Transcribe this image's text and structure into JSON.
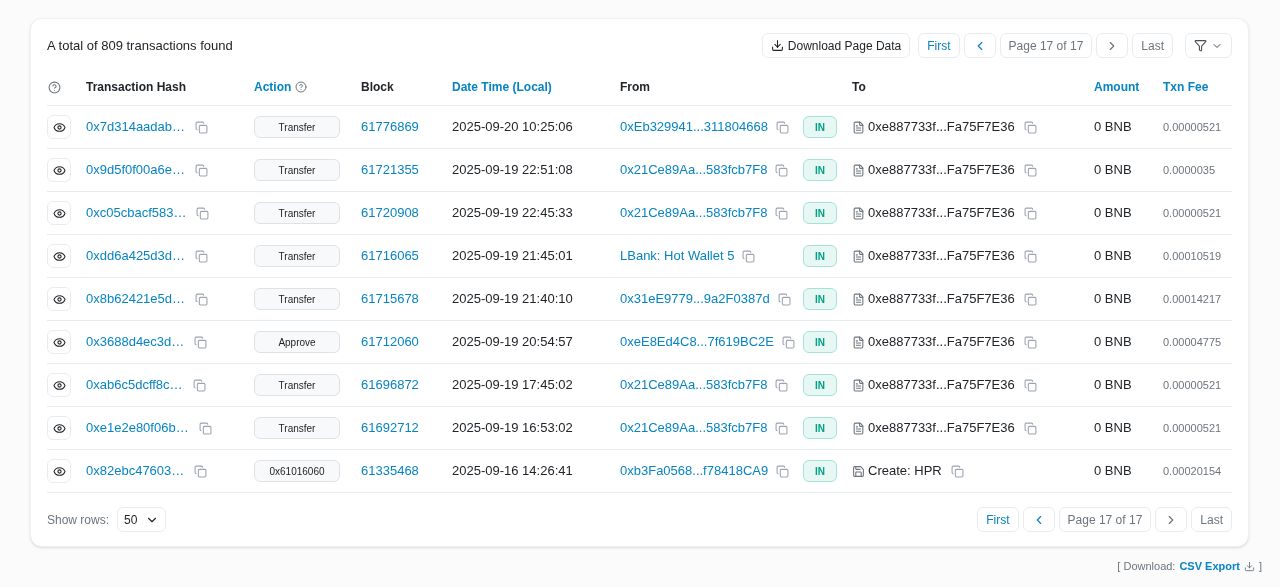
{
  "summary": "A total of 809 transactions found",
  "toolbar": {
    "download": "Download Page Data"
  },
  "pager_top": {
    "first": {
      "label": "First",
      "disabled": false
    },
    "prev_disabled": false,
    "page": "Page 17 of 17",
    "next_disabled": true,
    "last": {
      "label": "Last",
      "disabled": true
    }
  },
  "columns": [
    {
      "label": "Transaction Hash",
      "link": false,
      "help": false
    },
    {
      "label": "Action",
      "link": true,
      "help": true
    },
    {
      "label": "Block",
      "link": false,
      "help": false
    },
    {
      "label": "Date Time (Local)",
      "link": true,
      "help": false
    },
    {
      "label": "From",
      "link": false,
      "help": false
    },
    {
      "label": "To",
      "link": false,
      "help": false
    },
    {
      "label": "Amount",
      "link": true,
      "help": false
    },
    {
      "label": "Txn Fee",
      "link": true,
      "help": false
    }
  ],
  "rows": [
    {
      "hash": "0x7d314aadab…",
      "action": "Transfer",
      "block": "61776869",
      "time": "2025-09-20 10:25:06",
      "from": "0xEb329941...311804668",
      "direction": "IN",
      "to": {
        "kind": "contract",
        "text": "0xe887733f...Fa75F7E36"
      },
      "amount": "0 BNB",
      "fee": "0.00000521"
    },
    {
      "hash": "0x9d5f0f00a6e…",
      "action": "Transfer",
      "block": "61721355",
      "time": "2025-09-19 22:51:08",
      "from": "0x21Ce89Aa...583fcb7F8",
      "direction": "IN",
      "to": {
        "kind": "contract",
        "text": "0xe887733f...Fa75F7E36"
      },
      "amount": "0 BNB",
      "fee": "0.0000035"
    },
    {
      "hash": "0xc05cbacf583…",
      "action": "Transfer",
      "block": "61720908",
      "time": "2025-09-19 22:45:33",
      "from": "0x21Ce89Aa...583fcb7F8",
      "direction": "IN",
      "to": {
        "kind": "contract",
        "text": "0xe887733f...Fa75F7E36"
      },
      "amount": "0 BNB",
      "fee": "0.00000521"
    },
    {
      "hash": "0xdd6a425d3d…",
      "action": "Transfer",
      "block": "61716065",
      "time": "2025-09-19 21:45:01",
      "from": "LBank: Hot Wallet 5",
      "direction": "IN",
      "to": {
        "kind": "contract",
        "text": "0xe887733f...Fa75F7E36"
      },
      "amount": "0 BNB",
      "fee": "0.00010519"
    },
    {
      "hash": "0x8b62421e5d…",
      "action": "Transfer",
      "block": "61715678",
      "time": "2025-09-19 21:40:10",
      "from": "0x31eE9779...9a2F0387d",
      "direction": "IN",
      "to": {
        "kind": "contract",
        "text": "0xe887733f...Fa75F7E36"
      },
      "amount": "0 BNB",
      "fee": "0.00014217"
    },
    {
      "hash": "0x3688d4ec3d…",
      "action": "Approve",
      "block": "61712060",
      "time": "2025-09-19 20:54:57",
      "from": "0xeE8Ed4C8...7f619BC2E",
      "direction": "IN",
      "to": {
        "kind": "contract",
        "text": "0xe887733f...Fa75F7E36"
      },
      "amount": "0 BNB",
      "fee": "0.00004775"
    },
    {
      "hash": "0xab6c5dcff8c…",
      "action": "Transfer",
      "block": "61696872",
      "time": "2025-09-19 17:45:02",
      "from": "0x21Ce89Aa...583fcb7F8",
      "direction": "IN",
      "to": {
        "kind": "contract",
        "text": "0xe887733f...Fa75F7E36"
      },
      "amount": "0 BNB",
      "fee": "0.00000521"
    },
    {
      "hash": "0xe1e2e80f06b…",
      "action": "Transfer",
      "block": "61692712",
      "time": "2025-09-19 16:53:02",
      "from": "0x21Ce89Aa...583fcb7F8",
      "direction": "IN",
      "to": {
        "kind": "contract",
        "text": "0xe887733f...Fa75F7E36"
      },
      "amount": "0 BNB",
      "fee": "0.00000521"
    },
    {
      "hash": "0x82ebc47603…",
      "action": "0x61016060",
      "block": "61335468",
      "time": "2025-09-16 14:26:41",
      "from": "0xb3Fa0568...f78418CA9",
      "direction": "IN",
      "to": {
        "kind": "create",
        "text": "Create: HPR"
      },
      "amount": "0 BNB",
      "fee": "0.00020154"
    }
  ],
  "show_rows": {
    "label": "Show rows:",
    "value": "50"
  },
  "pager_bottom": {
    "first": {
      "label": "First",
      "disabled": false
    },
    "prev_disabled": false,
    "page": "Page 17 of 17",
    "next_disabled": true,
    "last": {
      "label": "Last",
      "disabled": true
    }
  },
  "csv": {
    "open": "[ Download:",
    "link": "CSV Export",
    "close": "]"
  }
}
